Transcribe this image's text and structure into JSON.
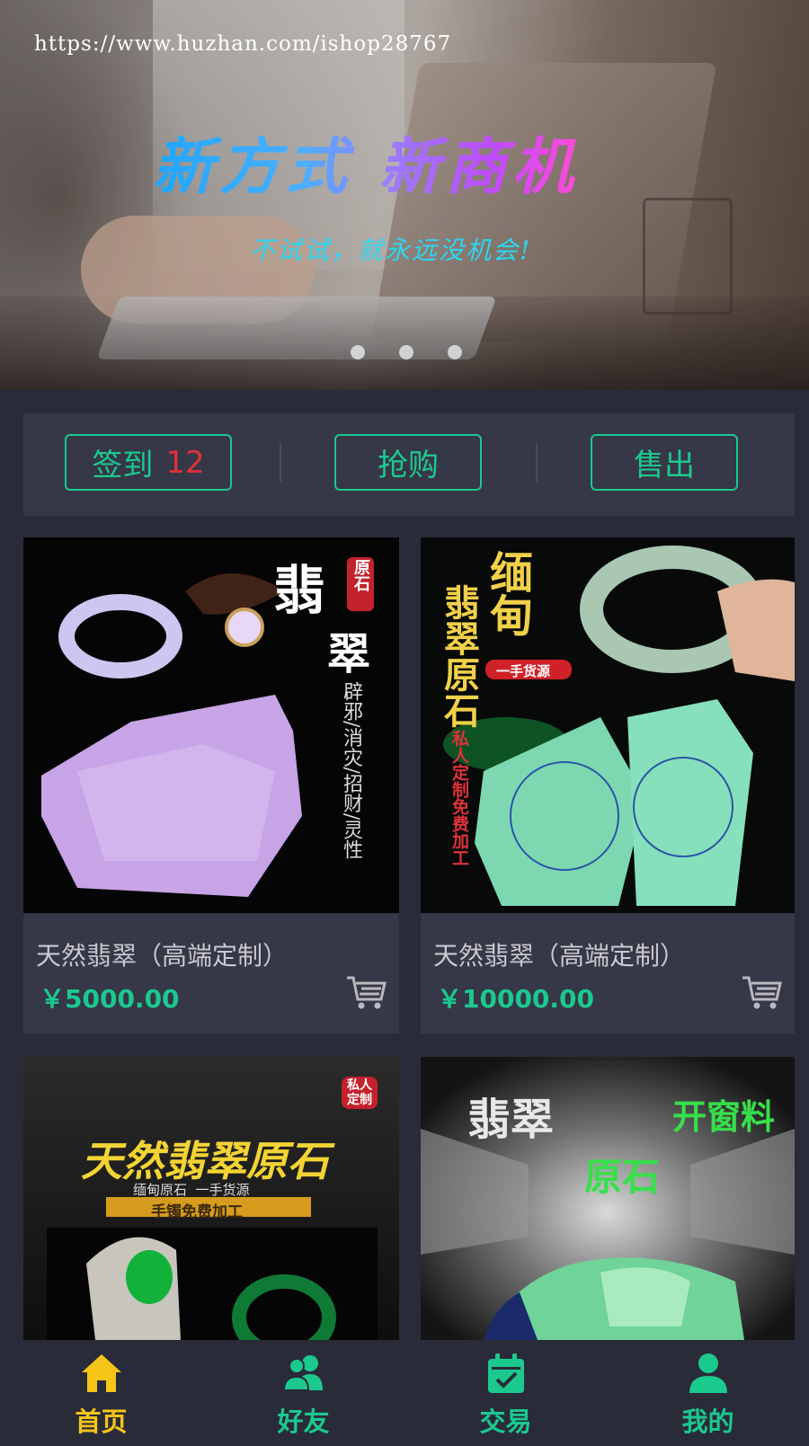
{
  "banner": {
    "watermark": "https://www.huzhan.com/ishop28767",
    "headline": "新方式 新商机",
    "subline": "不试试，就永远没机会!",
    "slide_count": 3
  },
  "actions": {
    "signin_label": "签到",
    "signin_count": "12",
    "buy_label": "抢购",
    "sell_label": "售出"
  },
  "products": [
    {
      "title": "天然翡翠（高端定制）",
      "price": "￥5000.00",
      "image_text": {
        "big1": "翡",
        "big2": "翠",
        "tag": "原石",
        "side": "辟邪/消灾/招财/灵性"
      }
    },
    {
      "title": "天然翡翠（高端定制）",
      "price": "￥10000.00",
      "image_text": {
        "big": "缅甸",
        "vertical": "翡翠原石",
        "tag": "一手货源",
        "side": "私人定制免费加工"
      }
    },
    {
      "title": "",
      "price": "",
      "image_text": {
        "headline": "天然翡翠原石",
        "sub": "缅甸原石  一手货源",
        "band": "手镯免费加工",
        "tag": "私人定制"
      }
    },
    {
      "title": "",
      "price": "",
      "image_text": {
        "a": "翡翠",
        "b": "开窗料",
        "c": "原石"
      }
    }
  ],
  "tabbar": {
    "items": [
      {
        "label": "首页",
        "icon": "home-icon",
        "active": true
      },
      {
        "label": "好友",
        "icon": "friends-icon",
        "active": false
      },
      {
        "label": "交易",
        "icon": "trade-calendar-icon",
        "active": false
      },
      {
        "label": "我的",
        "icon": "user-icon",
        "active": false
      }
    ]
  },
  "colors": {
    "background": "#2a2b39",
    "panel": "#363747",
    "accent": "#1bc98e",
    "active_tab": "#f5c518",
    "count_red": "#e2303a"
  }
}
